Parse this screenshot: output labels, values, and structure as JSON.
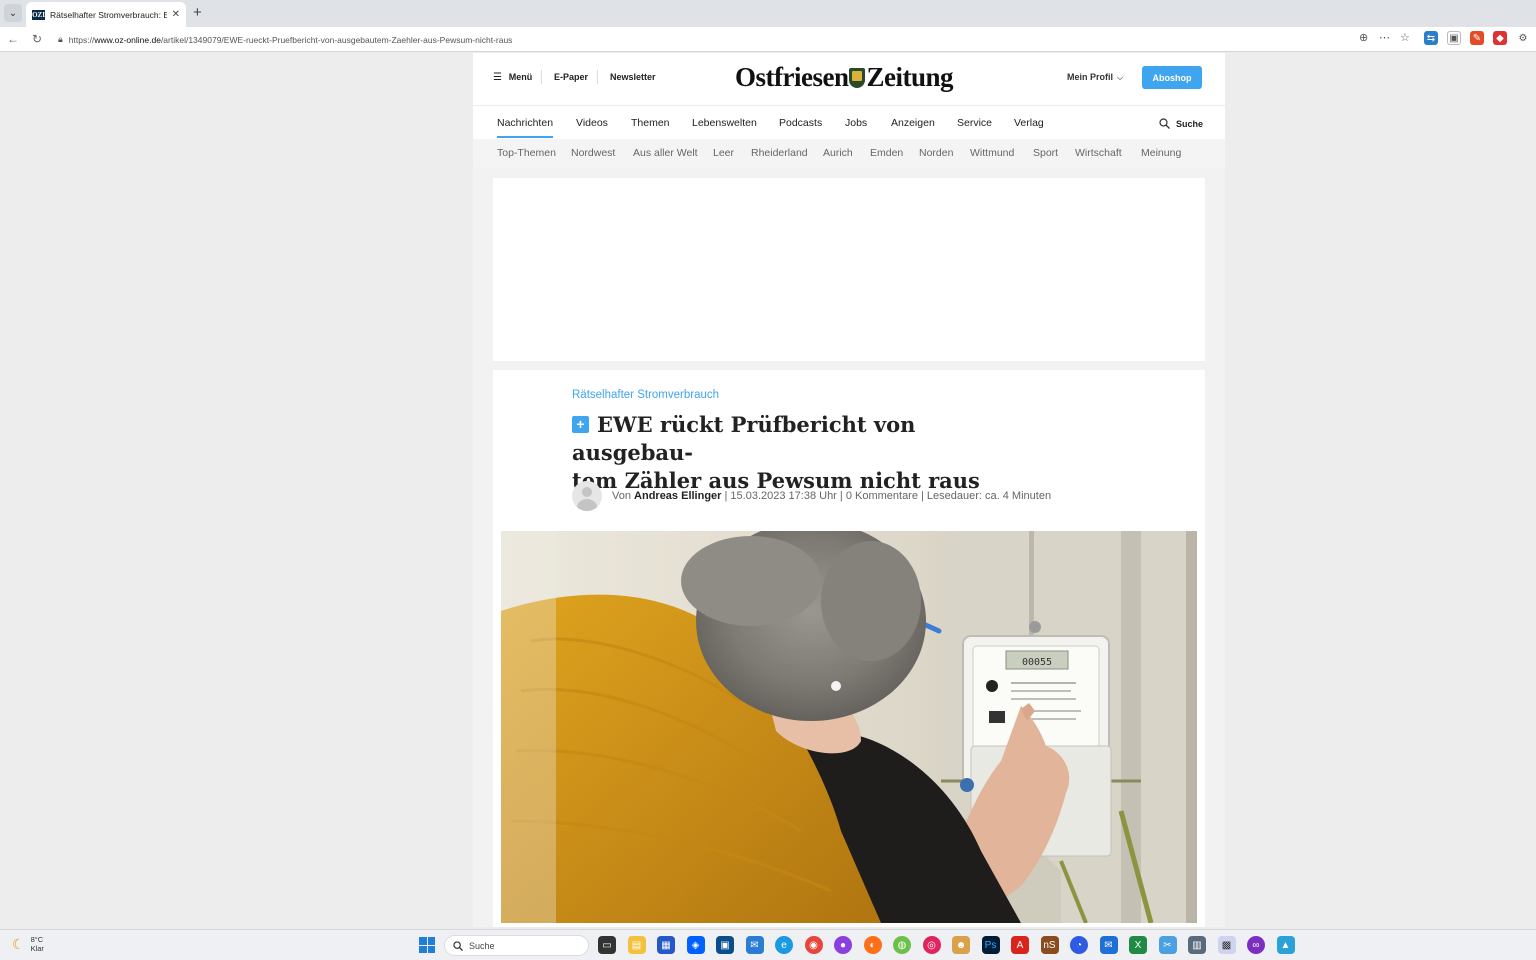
{
  "browser": {
    "tab": {
      "favicon_text": "OZI",
      "title": "Rätselhafter Stromverbrauch: EWE",
      "close_glyph": "✕"
    },
    "new_tab_glyph": "+",
    "url": {
      "scheme_prefix": "https://",
      "host": "www.oz-online.de",
      "path": "/artikel/1349079/EWE-rueckt-Pruefbericht-von-ausgebautem-Zaehler-aus-Pewsum-nicht-raus"
    }
  },
  "header": {
    "menu_label": "Menü",
    "epaper_label": "E-Paper",
    "newsletter_label": "Newsletter",
    "logo_part1": "Ostfriesen",
    "logo_part2": "Zeitung",
    "profile_label": "Mein Profil",
    "aboshop_label": "Aboshop"
  },
  "main_nav": {
    "items": [
      "Nachrichten",
      "Videos",
      "Themen",
      "Lebenswelten",
      "Podcasts",
      "Jobs",
      "Anzeigen",
      "Service",
      "Verlag"
    ],
    "active": "Nachrichten",
    "search_label": "Suche"
  },
  "sub_nav": {
    "items": [
      "Top-Themen",
      "Nordwest",
      "Aus aller Welt",
      "Leer",
      "Rheiderland",
      "Aurich",
      "Emden",
      "Norden",
      "Wittmund",
      "Sport",
      "Wirtschaft",
      "Meinung"
    ]
  },
  "article": {
    "kicker": "Rätselhafter Stromverbrauch",
    "plus_badge": "+",
    "headline_line1": "EWE rückt Prüfbericht von ausgebau-",
    "headline_line2": "tem Zähler aus Pewsum nicht raus",
    "meta_prefix": "Von",
    "author": "Andreas Ellinger",
    "meta_rest": "| 15.03.2023 17:38 Uhr | 0 Kommentare | Lesedauer: ca. 4 Minuten",
    "meter_display": "00055"
  },
  "taskbar": {
    "temperature": "8°C",
    "condition": "Klar",
    "search_label": "Suche"
  },
  "colors": {
    "accent": "#3fa5ee",
    "navy": "#0e2a47"
  }
}
